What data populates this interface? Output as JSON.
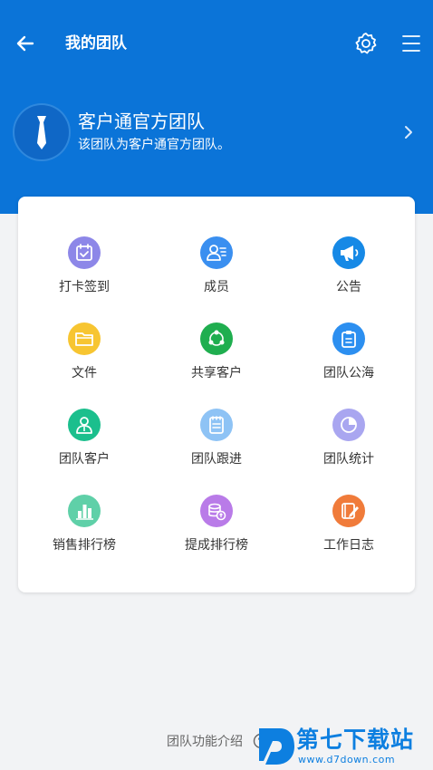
{
  "topbar": {
    "title": "我的团队",
    "back_icon": "arrow-left-icon",
    "settings_icon": "gear-icon",
    "menu_icon": "hamburger-menu-icon"
  },
  "team": {
    "name": "客户通官方团队",
    "description": "该团队为客户通官方团队。",
    "avatar_icon": "necktie-icon"
  },
  "colors": {
    "header": "#0b74d8",
    "background": "#f2f3f5",
    "watermark": "#0d7fe0"
  },
  "features": [
    {
      "label": "打卡签到",
      "icon": "calendar-check-icon",
      "color": "#8d87e8"
    },
    {
      "label": "成员",
      "icon": "members-icon",
      "color": "#3a8ff0"
    },
    {
      "label": "公告",
      "icon": "megaphone-icon",
      "color": "#1689e6"
    },
    {
      "label": "文件",
      "icon": "folder-icon",
      "color": "#f7c531"
    },
    {
      "label": "共享客户",
      "icon": "share-nodes-icon",
      "color": "#1fae4f"
    },
    {
      "label": "团队公海",
      "icon": "clipboard-icon",
      "color": "#2c8ff0"
    },
    {
      "label": "团队客户",
      "icon": "customer-icon",
      "color": "#1bbf8d"
    },
    {
      "label": "团队跟进",
      "icon": "notepad-icon",
      "color": "#8ec3f5"
    },
    {
      "label": "团队统计",
      "icon": "pie-chart-icon",
      "color": "#a9a6f0"
    },
    {
      "label": "销售排行榜",
      "icon": "bar-chart-icon",
      "color": "#5fd0a8"
    },
    {
      "label": "提成排行榜",
      "icon": "coins-icon",
      "color": "#b97be8"
    },
    {
      "label": "工作日志",
      "icon": "edit-log-icon",
      "color": "#f07b3a"
    }
  ],
  "footer": {
    "intro_link": "团队功能介绍",
    "help_icon": "question-circle-icon"
  },
  "watermark": {
    "title": "第七下载站",
    "url": "www.d7down.com"
  }
}
